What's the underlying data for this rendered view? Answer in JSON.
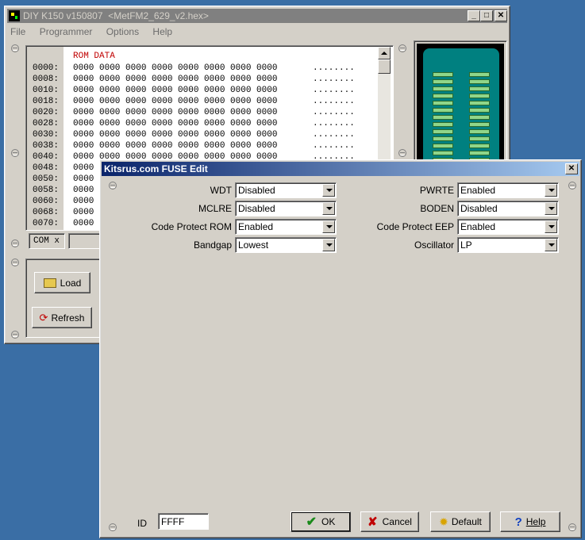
{
  "main_window": {
    "title": "DIY K150 v150807  <MetFM2_629_v2.hex>",
    "menu": [
      "File",
      "Programmer",
      "Options",
      "Help"
    ],
    "rom_header": "ROM DATA",
    "rom_rows": [
      {
        "addr": "0000:",
        "data": "0000 0000 0000 0000 0000 0000 0000 0000",
        "ascii": "........"
      },
      {
        "addr": "0008:",
        "data": "0000 0000 0000 0000 0000 0000 0000 0000",
        "ascii": "........"
      },
      {
        "addr": "0010:",
        "data": "0000 0000 0000 0000 0000 0000 0000 0000",
        "ascii": "........"
      },
      {
        "addr": "0018:",
        "data": "0000 0000 0000 0000 0000 0000 0000 0000",
        "ascii": "........"
      },
      {
        "addr": "0020:",
        "data": "0000 0000 0000 0000 0000 0000 0000 0000",
        "ascii": "........"
      },
      {
        "addr": "0028:",
        "data": "0000 0000 0000 0000 0000 0000 0000 0000",
        "ascii": "........"
      },
      {
        "addr": "0030:",
        "data": "0000 0000 0000 0000 0000 0000 0000 0000",
        "ascii": "........"
      },
      {
        "addr": "0038:",
        "data": "0000 0000 0000 0000 0000 0000 0000 0000",
        "ascii": "........"
      },
      {
        "addr": "0040:",
        "data": "0000 0000 0000 0000 0000 0000 0000 0000",
        "ascii": "........"
      },
      {
        "addr": "0048:",
        "data": "0000",
        "ascii": ""
      },
      {
        "addr": "0050:",
        "data": "0000",
        "ascii": ""
      },
      {
        "addr": "0058:",
        "data": "0000",
        "ascii": ""
      },
      {
        "addr": "0060:",
        "data": "0000",
        "ascii": ""
      },
      {
        "addr": "0068:",
        "data": "0000",
        "ascii": ""
      },
      {
        "addr": "0070:",
        "data": "0000",
        "ascii": ""
      }
    ],
    "com_label": "COM x",
    "load_label": "Load",
    "refresh_label": "Refresh"
  },
  "fuse_dialog": {
    "title": "Kitsrus.com FUSE Edit",
    "left_fields": [
      {
        "label": "WDT",
        "value": "Disabled"
      },
      {
        "label": "MCLRE",
        "value": "Disabled"
      },
      {
        "label": "Code Protect ROM",
        "value": "Enabled"
      },
      {
        "label": "Bandgap",
        "value": "Lowest"
      }
    ],
    "right_fields": [
      {
        "label": "PWRTE",
        "value": "Enabled"
      },
      {
        "label": "BODEN",
        "value": "Disabled"
      },
      {
        "label": "Code Protect EEP",
        "value": "Enabled"
      },
      {
        "label": "Oscillator",
        "value": "LP"
      }
    ],
    "id_label": "ID",
    "id_value": "FFFF",
    "buttons": {
      "ok": "OK",
      "cancel": "Cancel",
      "default": "Default",
      "help": "Help"
    }
  },
  "colors": {
    "desktop": "#3a6ea5",
    "rom_header": "#c00000",
    "active_title": "#0a246a",
    "socket": "#008080"
  },
  "icons": [
    "app-icon",
    "minimize-icon",
    "maximize-icon",
    "close-icon",
    "folder-open-icon",
    "refresh-icon",
    "checkmark-icon",
    "cross-icon",
    "sun-icon",
    "question-icon"
  ]
}
